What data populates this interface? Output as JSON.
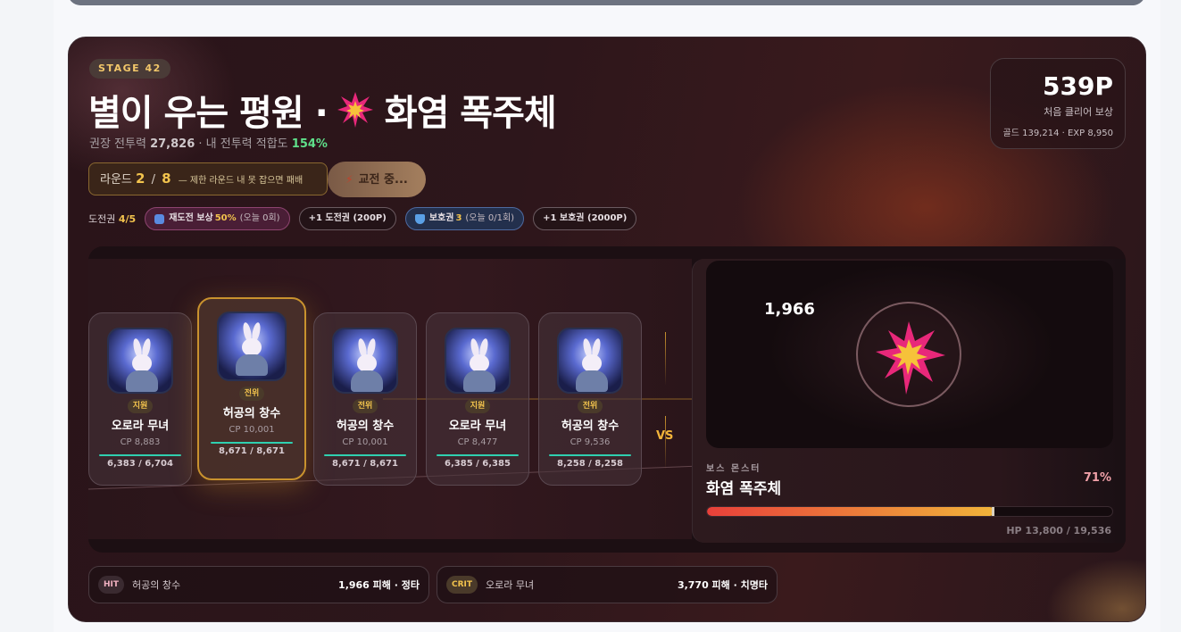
{
  "stage": {
    "badge": "STAGE 42",
    "title_part1": "별이 우는 평원 ·",
    "title_part2": "화염 폭주체",
    "recommended_label": "권장 전투력",
    "recommended_value": "27,826",
    "my_label": "· 내 전투력 적합도",
    "my_value": "154%"
  },
  "reward": {
    "points": "539P",
    "label": "처음 클리어 보상",
    "detail": "골드 139,214 · EXP 8,950"
  },
  "round": {
    "label": "라운드",
    "current": "2",
    "sep": "/",
    "total": "8",
    "warning": "— 제한 라운드 내 못 잡으면 패배"
  },
  "swap_button": "교전 중...",
  "tickets": {
    "label": "도전권",
    "value": "4/5",
    "retry_label": "재도전 보상",
    "retry_pct": "50%",
    "retry_note": "(오늘 0회)",
    "buy_ticket": "+1 도전권 (200P)",
    "shield_label": "보호권",
    "shield_count": "3",
    "shield_note": "(오늘 0/1회)",
    "buy_shield": "+1 보호권 (2000P)"
  },
  "heroes": [
    {
      "role": "지원",
      "name": "오로라 무녀",
      "cp": "CP 8,883",
      "hp": "6,383 / 6,704"
    },
    {
      "role": "전위",
      "name": "허공의 창수",
      "cp": "CP 10,001",
      "hp": "8,671 / 8,671"
    },
    {
      "role": "전위",
      "name": "허공의 창수",
      "cp": "CP 10,001",
      "hp": "8,671 / 8,671"
    },
    {
      "role": "지원",
      "name": "오로라 무녀",
      "cp": "CP 8,477",
      "hp": "6,385 / 6,385"
    },
    {
      "role": "전위",
      "name": "허공의 창수",
      "cp": "CP 9,536",
      "hp": "8,258 / 8,258"
    }
  ],
  "vs_label": "VS",
  "boss": {
    "damage_popup": "1,966",
    "section_label": "보스 몬스터",
    "name": "화염 폭주체",
    "hp_percent_label": "71%",
    "hp_fraction": 0.71,
    "hp_text": "HP 13,800 / 19,536"
  },
  "log": [
    {
      "tag": "HIT",
      "name": "허공의 창수",
      "damage": "1,966 피해 · 정타"
    },
    {
      "tag": "CRIT",
      "name": "오로라 무녀",
      "damage": "3,770 피해 · 치명타"
    }
  ],
  "colors": {
    "accent_gold": "#f2c34d",
    "fit_green": "#5fe08a",
    "hp_teal": "#2fd0b0",
    "boss_bar_start": "#e8403a",
    "boss_bar_end": "#f0b43a"
  },
  "icons": [
    "explosion-icon",
    "bolt-icon",
    "retry-icon",
    "shield-icon"
  ]
}
